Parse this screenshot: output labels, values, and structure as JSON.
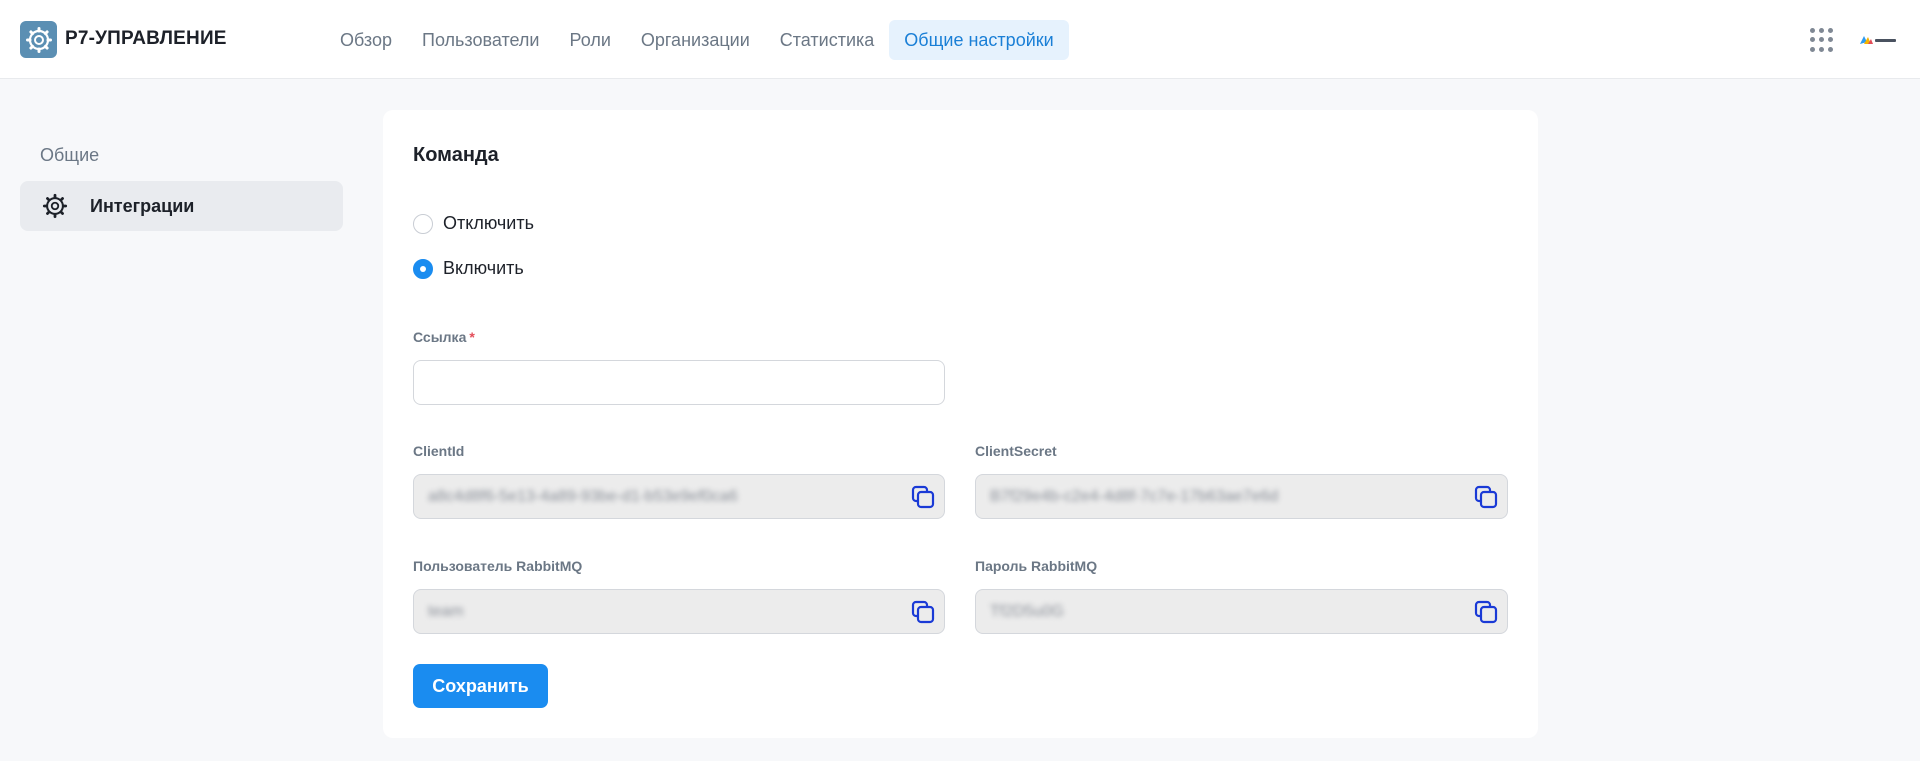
{
  "app": {
    "title": "Р7-УПРАВЛЕНИЕ",
    "logo_icon": "gear-icon"
  },
  "nav": {
    "items": [
      {
        "label": "Обзор"
      },
      {
        "label": "Пользователи"
      },
      {
        "label": "Роли"
      },
      {
        "label": "Организации"
      },
      {
        "label": "Статистика"
      },
      {
        "label": "Общие настройки",
        "active": true
      }
    ]
  },
  "header": {
    "apps_icon": "grid-icon",
    "corp_logo": "r7-office-logo"
  },
  "sidebar": {
    "heading": "Общие",
    "items": [
      {
        "label": "Интеграции",
        "icon": "gear-icon",
        "active": true
      }
    ]
  },
  "form": {
    "title": "Команда",
    "radios": [
      {
        "label": "Отключить",
        "checked": false
      },
      {
        "label": "Включить",
        "checked": true
      }
    ],
    "link": {
      "label": "Ссылка",
      "required_mark": "*",
      "value": ""
    },
    "client_id": {
      "label": "ClientId",
      "value": "a8c4d8f6-5e13-4a89-93be-d1-b53e9ef0ca6"
    },
    "client_secret": {
      "label": "ClientSecret",
      "value": "B7f29e4b-c2e4-4d8f-7c7e-17b63ae7e6d"
    },
    "rabbit_user": {
      "label": "Пользователь RabbitMQ",
      "value": "team"
    },
    "rabbit_password": {
      "label": "Пароль RabbitMQ",
      "value": "Tf2D5u0G"
    },
    "save_label": "Сохранить"
  },
  "colors": {
    "accent": "#1a8cf0",
    "active_tab_bg": "#e6f2fd",
    "required": "#e34d59"
  }
}
